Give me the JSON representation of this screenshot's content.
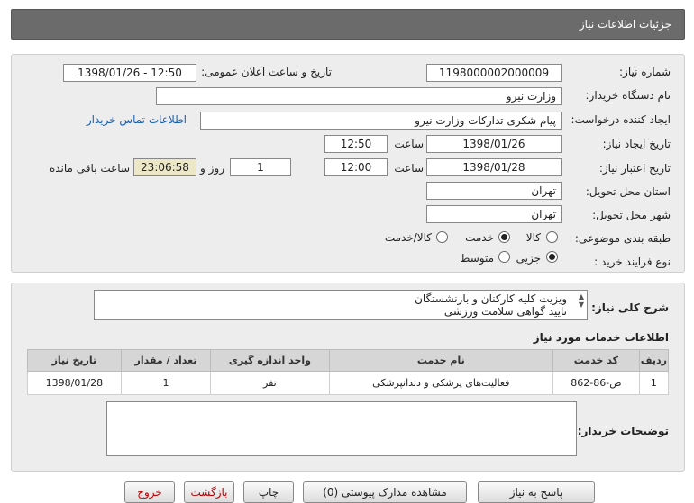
{
  "header": {
    "title": "جزئیات اطلاعات نیاز"
  },
  "fields": {
    "need_number_label": "شماره نیاز:",
    "need_number": "1198000002000009",
    "announce_label": "تاریخ و ساعت اعلان عمومی:",
    "announce_value": "1398/01/26 - 12:50",
    "buyer_org_label": "نام دستگاه خریدار:",
    "buyer_org": "وزارت نیرو",
    "requester_label": "ایجاد کننده درخواست:",
    "requester": "پیام شکری تدارکات وزارت نیرو",
    "contact_link": "اطلاعات تماس خریدار",
    "create_date_label": "تاریخ ایجاد نیاز:",
    "create_date": "1398/01/26",
    "time_label": "ساعت",
    "create_time": "12:50",
    "validity_label": "تاریخ اعتبار نیاز:",
    "validity_date": "1398/01/28",
    "validity_time": "12:00",
    "days_value": "1",
    "days_label": "روز و",
    "remaining_time": "23:06:58",
    "remaining_label": "ساعت باقی مانده",
    "province_label": "استان محل تحویل:",
    "province": "تهران",
    "city_label": "شهر محل تحویل:",
    "city": "تهران",
    "category_label": "طبقه بندی موضوعی:",
    "category_options": [
      "کالا",
      "خدمت",
      "کالا/خدمت"
    ],
    "category_selected": "خدمت",
    "process_label": "نوع فرآیند خرید :",
    "process_options": [
      "جزیی",
      "متوسط"
    ],
    "process_selected": "جزیی"
  },
  "summary": {
    "label": "شرح کلی نیاز:",
    "line1": "ویزیت کلیه کارکنان و بازنشستگان",
    "line2": "تایید گواهی سلامت ورزشی"
  },
  "services": {
    "title": "اطلاعات خدمات مورد نیاز",
    "columns": [
      "ردیف",
      "کد خدمت",
      "نام خدمت",
      "واحد اندازه گیری",
      "تعداد / مقدار",
      "تاریخ نیاز"
    ],
    "rows": [
      {
        "row": "1",
        "code": "ص-86-862",
        "name": "فعالیت‌های پزشکی و دندانپزشکی",
        "unit": "نفر",
        "qty": "1",
        "date": "1398/01/28"
      }
    ]
  },
  "buyer_notes": {
    "label": "توضیحات خریدار:",
    "value": ""
  },
  "buttons": {
    "reply": "پاسخ به نیاز",
    "view_docs": "مشاهده مدارک پیوستی (0)",
    "print": "چاپ",
    "back": "بازگشت",
    "exit": "خروج"
  }
}
